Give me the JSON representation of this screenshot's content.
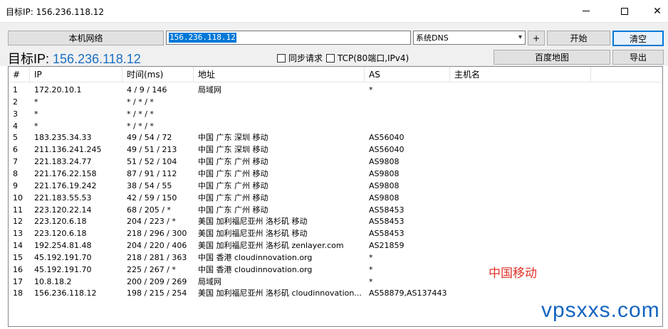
{
  "window": {
    "title": "目标IP: 156.236.118.12",
    "minimize": "—",
    "maximize": "□",
    "close": "✕"
  },
  "toolbar": {
    "local_network_label": "本机网络",
    "ip_value": "156.236.118.12",
    "dns_selected": "系统DNS",
    "plus_label": "+",
    "start_label": "开始",
    "clear_label": "清空",
    "baidu_map_label": "百度地图",
    "export_label": "导出",
    "sync_request_label": "同步请求",
    "tcp_label": "TCP(80端口,IPv4)"
  },
  "target": {
    "prefix": "目标IP:",
    "ip": "156.236.118.12"
  },
  "table": {
    "columns": [
      "#",
      "IP",
      "时间(ms)",
      "地址",
      "AS",
      "主机名"
    ],
    "rows": [
      {
        "n": "1",
        "ip": "172.20.10.1",
        "time": "4 / 9 / 146",
        "loc": "局域网",
        "as": "*"
      },
      {
        "n": "2",
        "ip": "*",
        "time": "* / * / *",
        "loc": "",
        "as": ""
      },
      {
        "n": "3",
        "ip": "*",
        "time": "* / * / *",
        "loc": "",
        "as": ""
      },
      {
        "n": "4",
        "ip": "*",
        "time": "* / * / *",
        "loc": "",
        "as": ""
      },
      {
        "n": "5",
        "ip": "183.235.34.33",
        "time": "49 / 54 / 72",
        "loc": "中国 广东 深圳 移动",
        "as": "AS56040"
      },
      {
        "n": "6",
        "ip": "211.136.241.245",
        "time": "49 / 51 / 213",
        "loc": "中国 广东 深圳 移动",
        "as": "AS56040"
      },
      {
        "n": "7",
        "ip": "221.183.24.77",
        "time": "51 / 52 / 104",
        "loc": "中国 广东 广州 移动",
        "as": "AS9808"
      },
      {
        "n": "8",
        "ip": "221.176.22.158",
        "time": "87 / 91 / 112",
        "loc": "中国 广东 广州 移动",
        "as": "AS9808"
      },
      {
        "n": "9",
        "ip": "221.176.19.242",
        "time": "38 / 54 / 55",
        "loc": "中国 广东 广州 移动",
        "as": "AS9808"
      },
      {
        "n": "10",
        "ip": "221.183.55.53",
        "time": "42 / 59 / 150",
        "loc": "中国 广东 广州 移动",
        "as": "AS9808"
      },
      {
        "n": "11",
        "ip": "223.120.22.14",
        "time": "68 / 205 / *",
        "loc": "中国 广东 广州 移动",
        "as": "AS58453"
      },
      {
        "n": "12",
        "ip": "223.120.6.18",
        "time": "204 / 223 / *",
        "loc": "美国 加利福尼亚州 洛杉矶 移动",
        "as": "AS58453"
      },
      {
        "n": "13",
        "ip": "223.120.6.18",
        "time": "218 / 296 / 300",
        "loc": "美国 加利福尼亚州 洛杉矶 移动",
        "as": "AS58453"
      },
      {
        "n": "14",
        "ip": "192.254.81.48",
        "time": "204 / 220 / 406",
        "loc": "美国 加利福尼亚州 洛杉矶 zenlayer.com",
        "as": "AS21859"
      },
      {
        "n": "15",
        "ip": "45.192.191.70",
        "time": "218 / 281 / 363",
        "loc": "中国 香港 cloudinnovation.org",
        "as": "*"
      },
      {
        "n": "16",
        "ip": "45.192.191.70",
        "time": "225 / 267 / *",
        "loc": "中国 香港 cloudinnovation.org",
        "as": "*"
      },
      {
        "n": "17",
        "ip": "10.8.18.2",
        "time": "200 / 209 / 269",
        "loc": "局域网",
        "as": "*"
      },
      {
        "n": "18",
        "ip": "156.236.118.12",
        "time": "198 / 215 / 254",
        "loc": "美国 加利福尼亚州 洛杉矶 cloudinnovation...",
        "as": "AS58879,AS137443"
      }
    ]
  },
  "watermark": {
    "carrier": "中国移动",
    "site": "vpsxxs.com"
  },
  "colors": {
    "accent": "#0078d7",
    "link_ip": "#1a6fc4",
    "carrier_red": "#e0322a",
    "site_blue": "#1565c0"
  }
}
